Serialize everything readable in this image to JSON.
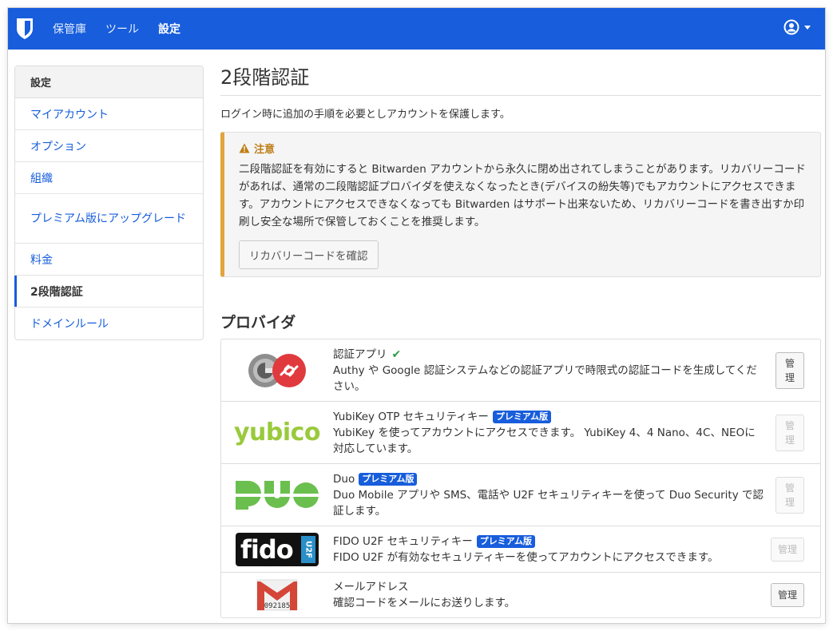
{
  "nav": {
    "links": [
      "保管庫",
      "ツール",
      "設定"
    ]
  },
  "sidebar": {
    "header": "設定",
    "items": [
      {
        "label": "マイアカウント"
      },
      {
        "label": "オプション"
      },
      {
        "label": "組織"
      },
      {
        "label": "プレミアム版にアップグレード"
      },
      {
        "label": "料金"
      },
      {
        "label": "2段階認証"
      },
      {
        "label": "ドメインルール"
      }
    ]
  },
  "main": {
    "title": "2段階認証",
    "lead": "ログイン時に追加の手順を必要としアカウントを保護します。",
    "warning": {
      "title": "注意",
      "body": "二段階認証を有効にすると Bitwarden アカウントから永久に閉め出されてしまうことがあります。リカバリーコードがあれば、通常の二段階認証プロバイダを使えなくなったとき(デバイスの紛失等)でもアカウントにアクセスできます。アカウントにアクセスできなくなっても Bitwarden はサポート出来ないため、リカバリーコードを書き出すか印刷し安全な場所で保管しておくことを推奨します。",
      "button": "リカバリーコードを確認"
    },
    "providers_title": "プロバイダ",
    "premium_badge": "プレミアム版",
    "manage_label": "管理",
    "manage_label_v": "管\n理",
    "providers": [
      {
        "name": "認証アプリ",
        "desc": "Authy や Google 認証システムなどの認証アプリで時限式の認証コードを生成してください。"
      },
      {
        "name": "YubiKey OTP セキュリティキー",
        "desc": "YubiKey を使ってアカウントにアクセスできます。 YubiKey 4、4 Nano、4C、NEOに対応しています。"
      },
      {
        "name": "Duo",
        "desc": "Duo Mobile アプリや SMS、電話や U2F セキュリティキーを使って Duo Security で認証します。"
      },
      {
        "name": "FIDO U2F セキュリティキー",
        "desc": "FIDO U2F が有効なセキュリティキーを使ってアカウントにアクセスできます。"
      },
      {
        "name": "メールアドレス",
        "desc": "確認コードをメールにお送りします。"
      }
    ],
    "logo_text": {
      "yubico": "yubico",
      "fido": "fido",
      "u2f": "U2F",
      "gmail_code": "092185"
    }
  },
  "colors": {
    "brand": "#175ddc",
    "warning": "#e0a53b",
    "success": "#2e9c4b"
  }
}
